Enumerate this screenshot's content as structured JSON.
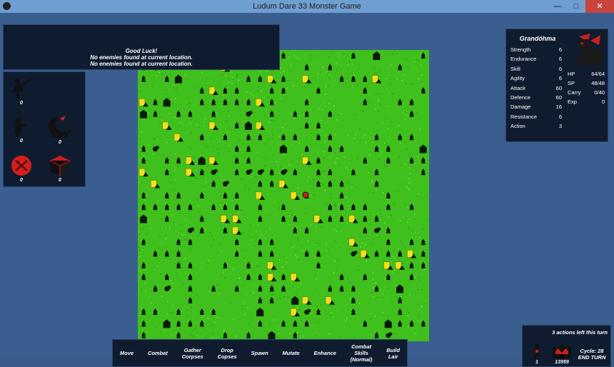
{
  "window": {
    "title": "Ludum Dare 33 Monster Game",
    "minimize_icon": "—",
    "maximize_icon": "□",
    "close_icon": "✕"
  },
  "messages": [
    "Good Luck!",
    "No enemies found at current location.",
    "No enemies found at current location."
  ],
  "monsters": [
    {
      "name": "warrior",
      "count": "0",
      "color": "#111111"
    },
    {
      "name": "zombie",
      "count": "0",
      "color": "#111111"
    },
    {
      "name": "ghoul",
      "count": "0",
      "color": "#111111"
    },
    {
      "name": "red-orb",
      "count": "0",
      "color": "#d41e1e"
    },
    {
      "name": "cube",
      "count": "0",
      "color": "#cc1f1f"
    }
  ],
  "character": {
    "name": "Grandóhma",
    "stats": [
      {
        "label": "Strength",
        "value": "6"
      },
      {
        "label": "Endurance",
        "value": "6"
      },
      {
        "label": "Skill",
        "value": "6"
      },
      {
        "label": "Agility",
        "value": "6"
      },
      {
        "label": "Attack",
        "value": "60"
      },
      {
        "label": "Defence",
        "value": "60"
      },
      {
        "label": "Damage",
        "value": "16"
      },
      {
        "label": "Resistance",
        "value": "6"
      },
      {
        "label": "Action",
        "value": "3"
      }
    ],
    "vitals": [
      {
        "label": "HP",
        "value": "64/64"
      },
      {
        "label": "SP",
        "value": "48/48"
      },
      {
        "label": "Carry",
        "value": "0/40"
      },
      {
        "label": "Exp",
        "value": "0"
      }
    ]
  },
  "actions": [
    {
      "id": "move",
      "label": "Move"
    },
    {
      "id": "combat",
      "label": "Combat"
    },
    {
      "id": "gather-corpses",
      "label": "Gather\nCorpses"
    },
    {
      "id": "drop-corpses",
      "label": "Drop\nCopses"
    },
    {
      "id": "spawn",
      "label": "Spawn"
    },
    {
      "id": "mutate",
      "label": "Mutate"
    },
    {
      "id": "enhance",
      "label": "Enhance"
    },
    {
      "id": "combat-skills",
      "label": "Combat\nSkills\n(Normal)"
    },
    {
      "id": "build-lair",
      "label": "Build\nLair"
    }
  ],
  "turn": {
    "actions_left": "3 actions left this turn",
    "minion_count": "1",
    "lair_value": "13959",
    "cycle": "Cycle: 28",
    "end_turn": "END TURN"
  },
  "colors": {
    "grass": "#3fc01c",
    "house": "#f0e020",
    "panel": "#0f1c30",
    "accent_red": "#cc1f1f"
  }
}
